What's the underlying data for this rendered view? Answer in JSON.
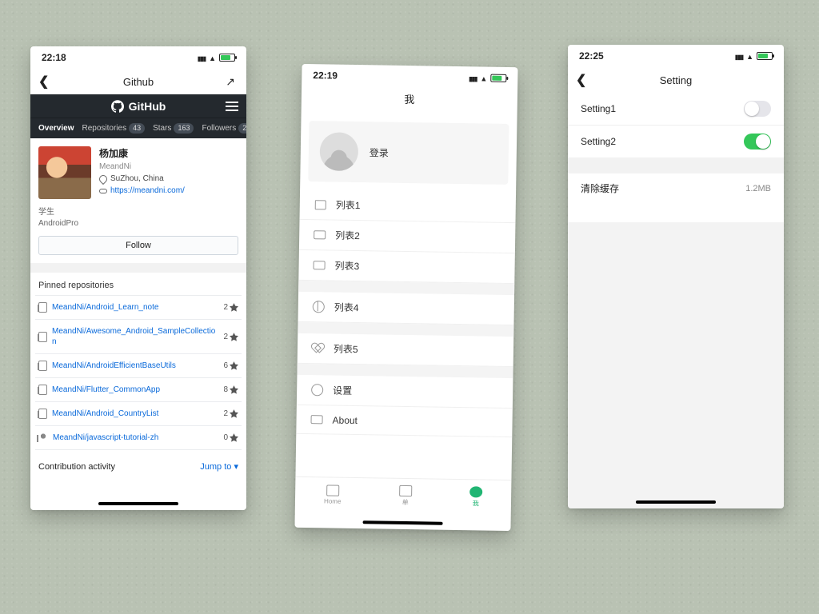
{
  "phone1": {
    "status_time": "22:18",
    "ios_title": "Github",
    "gh_brand": "GitHub",
    "tabs": {
      "overview": "Overview",
      "repos_label": "Repositories",
      "repos_count": "43",
      "stars_label": "Stars",
      "stars_count": "163",
      "followers_label": "Followers",
      "followers_count": "2"
    },
    "profile": {
      "name": "杨加康",
      "handle": "MeandNi",
      "location": "SuZhou, China",
      "site": "https://meandni.com/",
      "bio_line1": "学生",
      "bio_line2": "AndroidPro"
    },
    "follow_btn": "Follow",
    "pinned_title": "Pinned repositories",
    "repos": [
      {
        "name": "MeandNi/Android_Learn_note",
        "stars": "2"
      },
      {
        "name": "MeandNi/Awesome_Android_SampleCollection",
        "stars": "2"
      },
      {
        "name": "MeandNi/AndroidEfficientBaseUtils",
        "stars": "6"
      },
      {
        "name": "MeandNi/Flutter_CommonApp",
        "stars": "8"
      },
      {
        "name": "MeandNi/Android_CountryList",
        "stars": "2"
      },
      {
        "name": "MeandNi/javascript-tutorial-zh",
        "stars": "0"
      }
    ],
    "contrib_title": "Contribution activity",
    "jump_label": "Jump to"
  },
  "phone2": {
    "status_time": "22:19",
    "title": "我",
    "login_label": "登录",
    "items": [
      {
        "icon": "book",
        "label": "列表1"
      },
      {
        "icon": "mail",
        "label": "列表2"
      },
      {
        "icon": "card",
        "label": "列表3"
      }
    ],
    "items2": [
      {
        "icon": "globe",
        "label": "列表4"
      }
    ],
    "items3": [
      {
        "icon": "heart",
        "label": "列表5"
      }
    ],
    "items4": [
      {
        "icon": "gear",
        "label": "设置"
      },
      {
        "icon": "mail",
        "label": "About"
      }
    ],
    "tabs": {
      "home": "Home",
      "second": "单",
      "me": "我"
    }
  },
  "phone3": {
    "status_time": "22:25",
    "title": "Setting",
    "row1_label": "Setting1",
    "row1_on": false,
    "row2_label": "Setting2",
    "row2_on": true,
    "cache_label": "清除缓存",
    "cache_value": "1.2MB"
  }
}
